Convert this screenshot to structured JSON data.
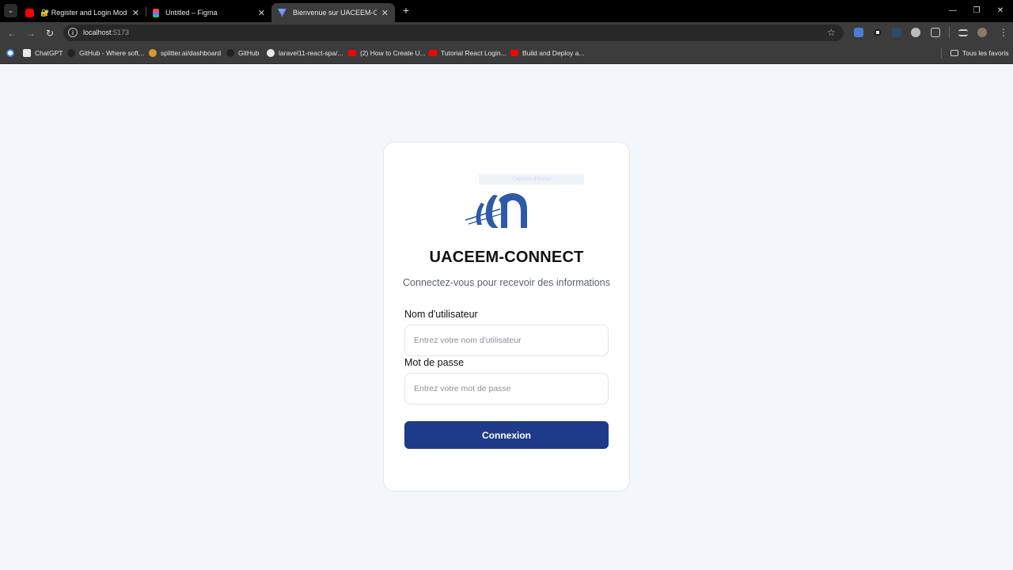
{
  "browser": {
    "tabs": [
      {
        "title": "🔐 Register and Login Module",
        "icon": "youtube-icon",
        "active": false
      },
      {
        "title": "Untitled – Figma",
        "icon": "figma-icon",
        "active": false
      },
      {
        "title": "Bienvenue sur UACEEM-CONNECT",
        "icon": "vite-icon",
        "active": true
      }
    ],
    "new_tab_label": "+",
    "url_host": "localhost",
    "url_port": ":5173",
    "bookmarks": [
      {
        "label": "ChatGPT",
        "icon": "chatgpt-icon"
      },
      {
        "label": "GitHub - Where soft...",
        "icon": "github-icon"
      },
      {
        "label": "splitter.ai/dashboard",
        "icon": "splitter-icon"
      },
      {
        "label": "GitHub",
        "icon": "github-icon"
      },
      {
        "label": "laravel11-react-spa/...",
        "icon": "github-icon"
      },
      {
        "label": "(2) How to Create U...",
        "icon": "youtube-icon"
      },
      {
        "label": "Tutorial React Login...",
        "icon": "youtube-icon"
      },
      {
        "label": "Build and Deploy a...",
        "icon": "youtube-icon"
      }
    ],
    "all_bookmarks_label": "Tous les favoris",
    "colors": {
      "tabbar": "#000000",
      "toolbar": "#3c3c3c",
      "youtube": "#ff0000"
    }
  },
  "login": {
    "logo_alt": "Capture d'écran",
    "brand": "UACEEM-CONNECT",
    "subtitle": "Connectez-vous pour recevoir des informations",
    "username_label": "Nom d'utilisateur",
    "username_placeholder": "Entrez votre nom d'utilisateur",
    "password_label": "Mot de passe",
    "password_placeholder": "Entrez votre mot de passe",
    "submit_label": "Connexion",
    "colors": {
      "background": "#f3f6fb",
      "button": "#1e3a8a",
      "logo": "#2f5aa8"
    }
  }
}
